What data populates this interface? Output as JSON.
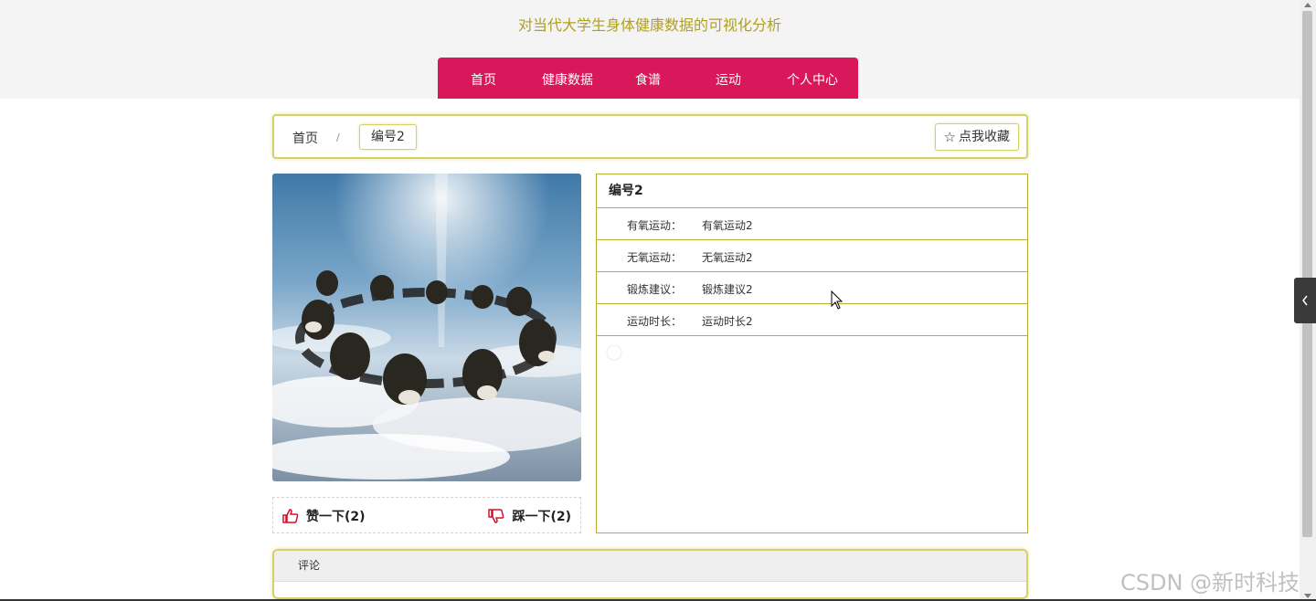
{
  "site": {
    "title": "对当代大学生身体健康数据的可视化分析"
  },
  "nav": {
    "items": [
      {
        "label": "首页"
      },
      {
        "label": "健康数据"
      },
      {
        "label": "食谱"
      },
      {
        "label": "运动"
      },
      {
        "label": "个人中心"
      }
    ]
  },
  "breadcrumb": {
    "home": "首页",
    "separator": "/",
    "current": "编号2"
  },
  "favorite": {
    "label": "点我收藏"
  },
  "detail": {
    "title": "编号2",
    "fields": [
      {
        "label": "有氧运动：",
        "value": "有氧运动2"
      },
      {
        "label": "无氧运动：",
        "value": "无氧运动2"
      },
      {
        "label": "锻炼建议：",
        "value": "锻炼建议2"
      },
      {
        "label": "运动时长：",
        "value": "运动时长2"
      }
    ]
  },
  "reactions": {
    "like_label": "赞一下(2)",
    "dislike_label": "踩一下(2)"
  },
  "comments": {
    "title": "评论"
  },
  "watermark": "CSDN @新时科技",
  "colors": {
    "brand": "#d8185a",
    "title": "#b0a01c",
    "border": "#d6d06a",
    "detail_border": "#b8ad2c",
    "reaction_icon": "#d0102a"
  }
}
